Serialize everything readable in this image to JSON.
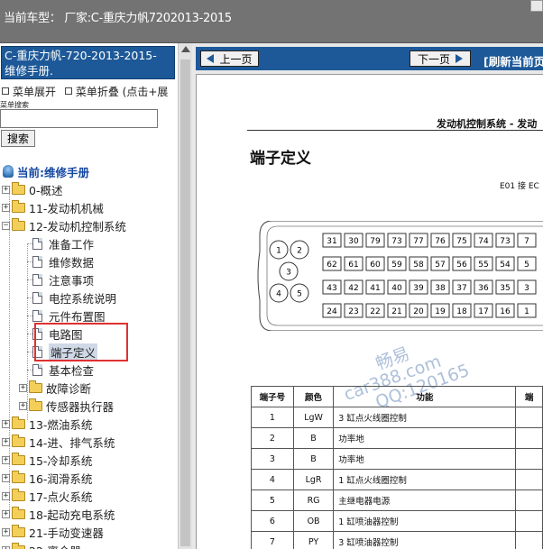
{
  "top_bar": {
    "title": "当前车型： 厂家:C-重庆力帆7202013-2015"
  },
  "sidebar": {
    "title": "C-重庆力帆-720-2013-2015- 维修手册.",
    "menu_expand": "菜单展开",
    "menu_collapse": "菜单折叠 (点击+展",
    "search_label": "菜单搜索",
    "search_value": "",
    "search_button": "搜索",
    "tree": [
      {
        "label": "当前:维修手册"
      },
      {
        "label": "0-概述"
      },
      {
        "label": "11-发动机机械"
      },
      {
        "label": "12-发动机控制系统"
      },
      {
        "label": "准备工作"
      },
      {
        "label": "维修数据"
      },
      {
        "label": "注意事项"
      },
      {
        "label": "电控系统说明"
      },
      {
        "label": "元件布置图"
      },
      {
        "label": "电路图"
      },
      {
        "label": "端子定义"
      },
      {
        "label": "基本检查"
      },
      {
        "label": "故障诊断"
      },
      {
        "label": "传感器执行器"
      },
      {
        "label": "13-燃油系统"
      },
      {
        "label": "14-进、排气系统"
      },
      {
        "label": "15-冷却系统"
      },
      {
        "label": "16-润滑系统"
      },
      {
        "label": "17-点火系统"
      },
      {
        "label": "18-起动充电系统"
      },
      {
        "label": "21-手动变速器"
      },
      {
        "label": "22-离合器"
      }
    ]
  },
  "nav": {
    "prev": "上一页",
    "next": "下一页",
    "refresh": "[刷新当前页"
  },
  "document": {
    "header": "发动机控制系统 - 发动",
    "title": "端子定义",
    "connector_label": "E01 接 EC",
    "connector_pins": {
      "round": [
        "1",
        "2",
        "3",
        "4",
        "5"
      ],
      "row1": [
        "31",
        "30",
        "79",
        "73",
        "77",
        "76",
        "75",
        "74",
        "73",
        "7"
      ],
      "row2": [
        "62",
        "61",
        "60",
        "59",
        "58",
        "57",
        "56",
        "55",
        "54",
        "5"
      ],
      "row3": [
        "43",
        "42",
        "41",
        "40",
        "39",
        "38",
        "37",
        "36",
        "35",
        "3"
      ],
      "row4": [
        "24",
        "23",
        "22",
        "21",
        "20",
        "19",
        "18",
        "17",
        "16",
        "1"
      ]
    },
    "watermark": [
      "畅易",
      "car388.com",
      "QQ:120165"
    ],
    "table": {
      "headers": [
        "端子号",
        "颜色",
        "功能",
        "端"
      ],
      "rows": [
        {
          "pin": "1",
          "color": "LgW",
          "function": "3 缸点火线圈控制"
        },
        {
          "pin": "2",
          "color": "B",
          "function": "功率地"
        },
        {
          "pin": "3",
          "color": "B",
          "function": "功率地"
        },
        {
          "pin": "4",
          "color": "LgR",
          "function": "1 缸点火线圈控制"
        },
        {
          "pin": "5",
          "color": "RG",
          "function": "主继电器电源"
        },
        {
          "pin": "6",
          "color": "OB",
          "function": "1 缸喷油器控制"
        },
        {
          "pin": "7",
          "color": "PY",
          "function": "3 缸喷油器控制"
        }
      ]
    }
  },
  "colors": {
    "nav_blue": "#1d5998",
    "highlight_red": "#e03030",
    "folder": "#f3cf5a"
  }
}
